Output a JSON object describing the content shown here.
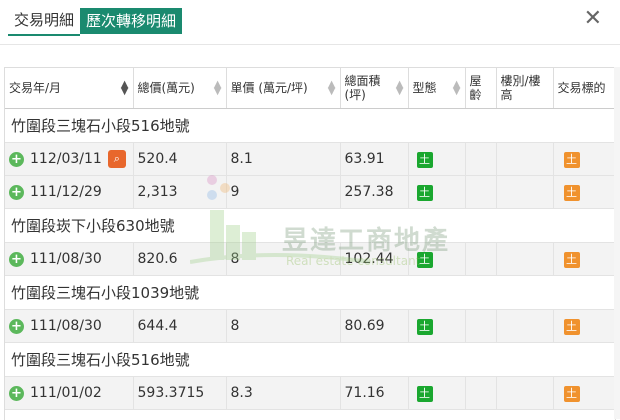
{
  "tabs": [
    {
      "label": "交易明細",
      "active": false
    },
    {
      "label": "歷次轉移明細",
      "active": true
    }
  ],
  "close_label": "✕",
  "columns": [
    {
      "label": "交易年/月",
      "sort": "dark"
    },
    {
      "label": "總價(萬元)",
      "sort": "light"
    },
    {
      "label": "單價 (萬元/坪)",
      "sort": "light"
    },
    {
      "label": "總面積\n(坪)",
      "sort": "light"
    },
    {
      "label": "型態",
      "sort": "light"
    },
    {
      "label": "屋齡",
      "sort": "none"
    },
    {
      "label": "樓別/樓高",
      "sort": "none"
    },
    {
      "label": "交易標的",
      "sort": "none"
    }
  ],
  "groups": [
    {
      "title": "竹圍段三塊石小段516地號",
      "rows": [
        {
          "date": "112/03/11",
          "total": "520.4",
          "unit": "8.1",
          "area": "63.91",
          "type": "土",
          "age": "",
          "floor": "",
          "target": "土",
          "has_search": true
        },
        {
          "date": "111/12/29",
          "total": "2,313",
          "unit": "9",
          "area": "257.38",
          "type": "土",
          "age": "",
          "floor": "",
          "target": "土",
          "has_search": false
        }
      ]
    },
    {
      "title": "竹圍段崁下小段630地號",
      "rows": [
        {
          "date": "111/08/30",
          "total": "820.6",
          "unit": "8",
          "area": "102.44",
          "type": "土",
          "age": "",
          "floor": "",
          "target": "土",
          "has_search": false
        }
      ]
    },
    {
      "title": "竹圍段三塊石小段1039地號",
      "rows": [
        {
          "date": "111/08/30",
          "total": "644.4",
          "unit": "8",
          "area": "80.69",
          "type": "土",
          "age": "",
          "floor": "",
          "target": "土",
          "has_search": false
        }
      ]
    },
    {
      "title": "竹圍段三塊石小段516地號",
      "rows": [
        {
          "date": "111/01/02",
          "total": "593.3715",
          "unit": "8.3",
          "area": "71.16",
          "type": "土",
          "age": "",
          "floor": "",
          "target": "土",
          "has_search": false
        }
      ]
    }
  ],
  "watermark": {
    "title": "昱達工商地產",
    "subtitle": "Real estate consultant"
  },
  "colors": {
    "accent": "#1a8a6f",
    "type_badge": "#1aa72f",
    "target_badge": "#f0922e",
    "add_icon": "#5cb85c"
  }
}
